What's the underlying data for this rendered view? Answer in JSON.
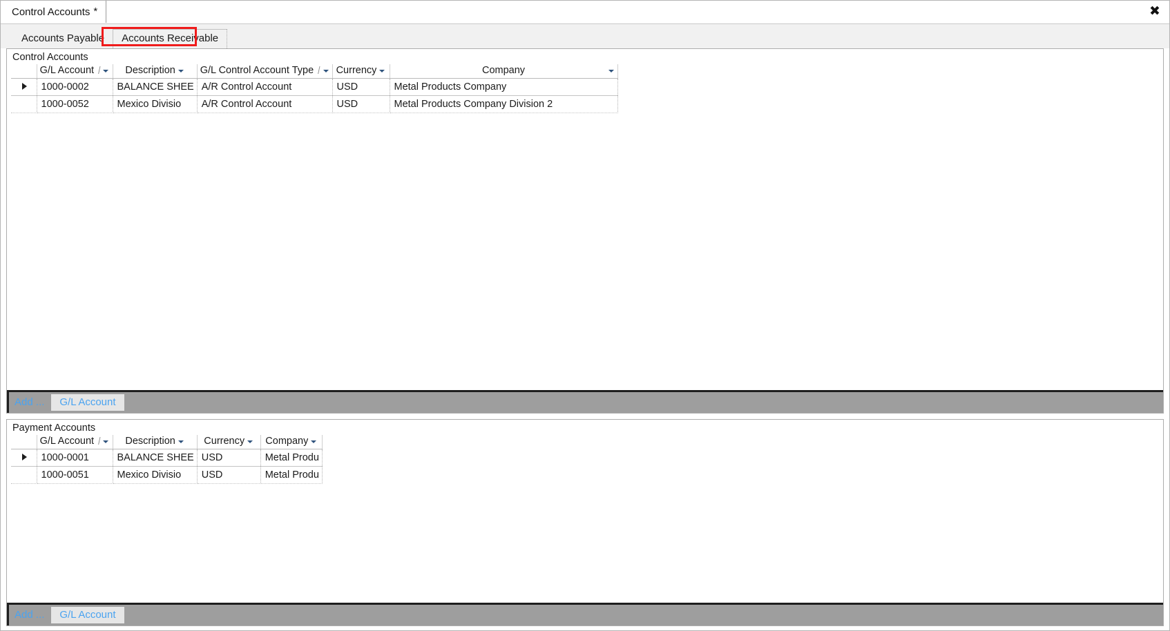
{
  "window": {
    "doc_tab_label": "Control Accounts",
    "doc_tab_dirty_marker": "*",
    "close_icon": "close-icon",
    "close_glyph": "✖"
  },
  "page_tabs": [
    {
      "label": "Accounts Payable",
      "active": false
    },
    {
      "label": "Accounts Receivable",
      "active": true
    }
  ],
  "annotation": {
    "color": "#f01b1b",
    "target": "Accounts Receivable"
  },
  "control_accounts": {
    "title": "Control Accounts",
    "columns": [
      {
        "label": "G/L Account",
        "sort": "/",
        "filter": true,
        "align": "center"
      },
      {
        "label": "Description",
        "sort": "",
        "filter": true,
        "align": "center"
      },
      {
        "label": "G/L Control Account Type",
        "sort": "/",
        "filter": true,
        "align": "center"
      },
      {
        "label": "Currency",
        "sort": "",
        "filter": true,
        "align": "center"
      },
      {
        "label": "Company",
        "sort": "",
        "filter": true,
        "align": "center"
      }
    ],
    "rows": [
      {
        "selected": true,
        "marker": "▶",
        "gl_account": "1000-0002",
        "description": "BALANCE SHEE",
        "account_type": "A/R Control Account",
        "currency": "USD",
        "company": "Metal Products Company"
      },
      {
        "selected": false,
        "marker": "",
        "gl_account": "1000-0052",
        "description": "Mexico Divisio",
        "account_type": "A/R Control Account",
        "currency": "USD",
        "company": "Metal Products Company Division 2"
      }
    ],
    "add_bar": {
      "label": "Add ...",
      "button_label": "G/L Account"
    }
  },
  "payment_accounts": {
    "title": "Payment Accounts",
    "columns": [
      {
        "label": "G/L Account",
        "sort": "/",
        "filter": true,
        "align": "center"
      },
      {
        "label": "Description",
        "sort": "",
        "filter": true,
        "align": "center"
      },
      {
        "label": "Currency",
        "sort": "",
        "filter": true,
        "align": "center"
      },
      {
        "label": "Company",
        "sort": "",
        "filter": true,
        "align": "center"
      }
    ],
    "rows": [
      {
        "selected": true,
        "marker": "▶",
        "gl_account": "1000-0001",
        "description": "BALANCE SHEE",
        "currency": "USD",
        "company": "Metal Produ"
      },
      {
        "selected": false,
        "marker": "",
        "gl_account": "1000-0051",
        "description": "Mexico Divisio",
        "currency": "USD",
        "company": "Metal Produ"
      }
    ],
    "add_bar": {
      "label": "Add ...",
      "button_label": "G/L Account"
    }
  }
}
